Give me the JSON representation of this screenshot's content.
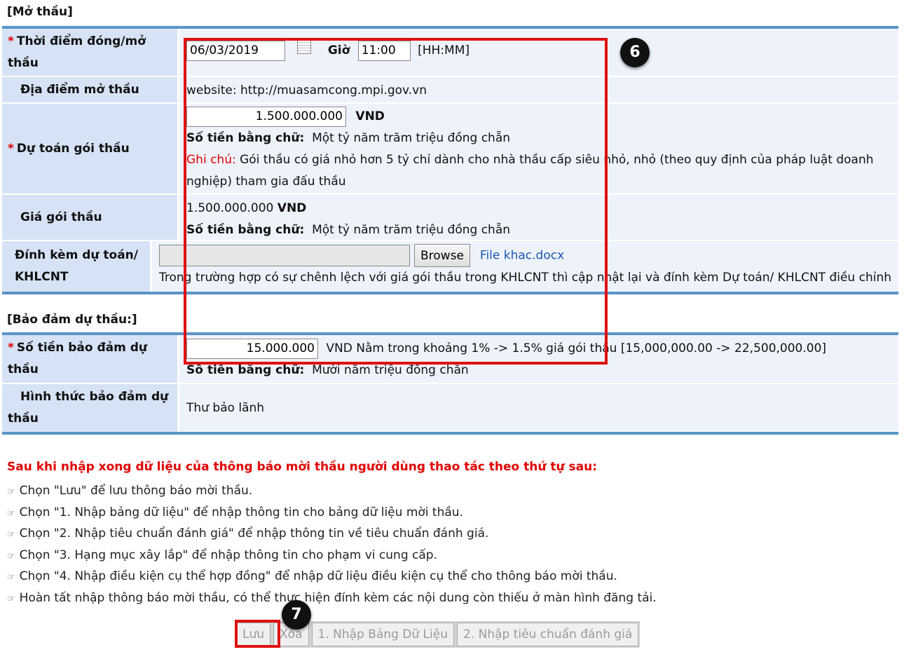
{
  "sections": {
    "open": "[Mở thầu]",
    "guarantee": "[Bảo đảm dự thầu:]"
  },
  "opening_time": {
    "label": "Thời điểm đóng/mở thầu",
    "date": "06/03/2019",
    "time_label": "Giờ",
    "time": "11:00",
    "time_format": "[HH:MM]"
  },
  "opening_place": {
    "label": "Địa điểm mở thầu",
    "value": "website: http://muasamcong.mpi.gov.vn"
  },
  "estimate": {
    "label": "Dự toán gói thầu",
    "amount": "1.500.000.000",
    "currency": "VND",
    "words_label": "Số tiền bằng chữ:",
    "words": "Một tỷ năm trăm triệu đồng chẵn",
    "note_label": "Ghi chú:",
    "note": "Gói thầu có giá nhỏ hơn 5 tỷ chỉ dành cho nhà thầu cấp siêu nhỏ, nhỏ (theo quy định của pháp luật doanh nghiệp) tham gia đấu thầu"
  },
  "package_price": {
    "label": "Giá gói thầu",
    "amount": "1.500.000.000",
    "currency": "VND",
    "words_label": "Số tiền bằng chữ:",
    "words": "Một tỷ năm trăm triệu đồng chẵn"
  },
  "attachment": {
    "label": "Đính kèm dự toán/ KHLCNT",
    "browse": "Browse",
    "file": "File khac.docx",
    "hint": "Trong trường hợp có sự chênh lệch với giá gói thầu trong KHLCNT thì cập nhật lại và đính kèm Dự toán/ KHLCNT điều chỉnh"
  },
  "guarantee_amount": {
    "label": "Số tiền bảo đảm dự thầu",
    "amount": "15.000.000",
    "range_text": "VND Nằm trong khoảng 1% -> 1.5% giá gói thầu [15,000,000.00 -> 22,500,000.00]",
    "words_label": "Số tiền bằng chữ:",
    "words": "Mười năm triệu đồng chẵn"
  },
  "guarantee_form": {
    "label": "Hình thức bảo đảm dự thầu",
    "value": "Thư bảo lãnh"
  },
  "badges": {
    "b6": "6",
    "b7": "7"
  },
  "instructions": {
    "title": "Sau khi nhập xong dữ liệu của thông báo mời thầu người dùng thao tác theo thứ tự sau:",
    "bullet": "☞",
    "items": [
      "Chọn \"Lưu\" để lưu thông báo mời thầu.",
      "Chọn \"1. Nhập bảng dữ liệu\" để nhập thông tin cho bảng dữ liệu mời thầu.",
      "Chọn \"2. Nhập tiêu chuẩn đánh giá\" để nhập thông tin về tiêu chuẩn đánh giá.",
      "Chọn \"3. Hạng mục xây lắp\" để nhập thông tin cho phạm vi cung cấp.",
      "Chọn \"4. Nhập điều kiện cụ thể hợp đồng\" để nhập dữ liệu điều kiện cụ thể cho thông báo mời thầu.",
      "Hoàn tất nhập thông báo mời thầu, có thể thực hiện đính kèm các nội dung còn thiếu ở màn hình đăng tải."
    ]
  },
  "buttons": {
    "save": "Lưu",
    "delete": "Xóa",
    "data_table": "1. Nhập Bảng Dữ Liệu",
    "criteria": "2. Nhập tiêu chuẩn đánh giá"
  },
  "colors": {
    "header_border": "#5a94c8",
    "label_bg": "#d6e3f6",
    "value_bg": "#eef3fb",
    "highlight": "#e01010"
  }
}
